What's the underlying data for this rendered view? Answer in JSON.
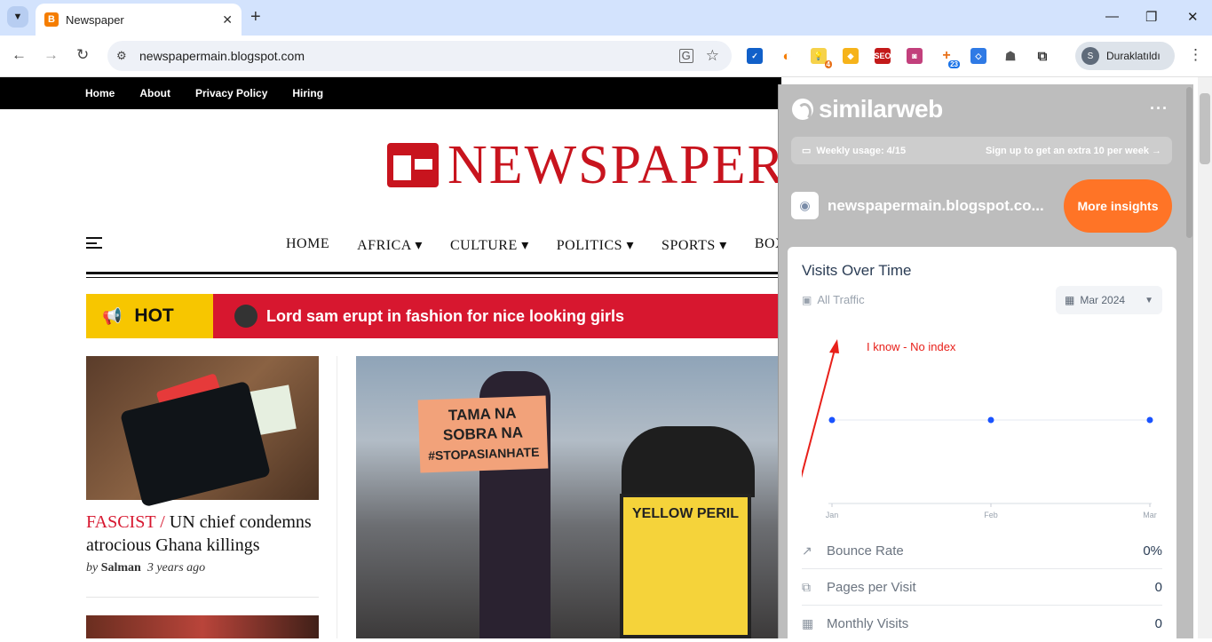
{
  "browser": {
    "tab_title": "Newspaper",
    "url": "newspapermain.blogspot.com",
    "profile_name": "Duraklatıldı",
    "profile_initial": "S",
    "extension_badges": [
      "4",
      "23"
    ],
    "icons": [
      "chevron-down-icon",
      "blogger-icon",
      "close-icon",
      "plus-icon",
      "back-icon",
      "forward-icon",
      "reload-icon",
      "site-info-icon",
      "translate-icon",
      "star-icon",
      "puzzle-icon",
      "kebab-menu-icon"
    ]
  },
  "site": {
    "top_nav": [
      "Home",
      "About",
      "Privacy Policy",
      "Hiring"
    ],
    "logo_text": "NEWSPAPER",
    "main_nav": [
      "HOME",
      "AFRICA ▾",
      "CULTURE ▾",
      "POLITICS ▾",
      "SPORTS ▾",
      "BOX"
    ],
    "hot_label": "HOT",
    "ticker_text": "Lord sam erupt in fashion for nice looking girls",
    "article1": {
      "category": "FASCIST",
      "slash": "/",
      "title": "UN chief condemns atrocious Ghana killings",
      "by": "by",
      "author": "Salman",
      "time": "3 years ago"
    },
    "image_signs": {
      "sign1_lines": [
        "TAMA NA",
        "SOBRA NA",
        "#STOPASIANHATE"
      ],
      "sign2": "YELLOW PERIL"
    },
    "colors": {
      "accent_red": "#d7172f",
      "hot_yellow": "#f7c600",
      "black": "#000000"
    }
  },
  "similarweb": {
    "brand": "similarweb",
    "menu": "···",
    "weekly_usage": "Weekly usage: 4/15",
    "signup_text": "Sign up to get an extra 10 per week →",
    "domain": "newspapermain.blogspot.co...",
    "more_insights": "More insights",
    "card_title": "Visits Over Time",
    "traffic_filter": "All Traffic",
    "date_select": "Mar 2024",
    "annotation": "I know - No index",
    "metrics": [
      {
        "label": "Bounce Rate",
        "value": "0%",
        "icon": "trend-icon"
      },
      {
        "label": "Pages per Visit",
        "value": "0",
        "icon": "pages-icon"
      },
      {
        "label": "Monthly Visits",
        "value": "0",
        "icon": "calendar-icon"
      }
    ],
    "colors": {
      "orange": "#ff7426",
      "point_blue": "#1a53ff",
      "annotation_red": "#e8201a"
    }
  },
  "chart_data": {
    "type": "line",
    "categories": [
      "Jan",
      "Feb",
      "Mar"
    ],
    "series": [
      {
        "values": [
          0,
          0,
          0
        ]
      }
    ],
    "title": "",
    "xlabel": "",
    "ylabel": "",
    "grid": false,
    "legend": "none"
  }
}
